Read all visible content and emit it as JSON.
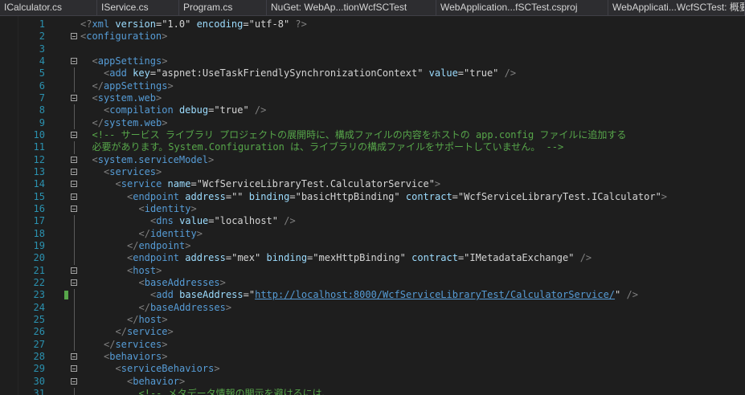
{
  "tabs": [
    {
      "label": "ICalculator.cs"
    },
    {
      "label": "IService.cs"
    },
    {
      "label": "Program.cs"
    },
    {
      "label": "NuGet: WebAp...tionWcfSCTest"
    },
    {
      "label": "WebApplication...fSCTest.csproj"
    },
    {
      "label": "WebApplicati...WcfSCTest: 概要"
    }
  ],
  "lines": [
    {
      "n": "1",
      "indent": 0,
      "fold": false,
      "tokens": [
        [
          "b",
          "<?"
        ],
        [
          "tag",
          "xml"
        ],
        [
          "txt",
          " "
        ],
        [
          "attr",
          "version"
        ],
        [
          "eq",
          "="
        ],
        [
          "q",
          "\""
        ],
        [
          "val",
          "1.0"
        ],
        [
          "q",
          "\""
        ],
        [
          "txt",
          " "
        ],
        [
          "attr",
          "encoding"
        ],
        [
          "eq",
          "="
        ],
        [
          "q",
          "\""
        ],
        [
          "val",
          "utf-8"
        ],
        [
          "q",
          "\""
        ],
        [
          "b",
          " ?>"
        ]
      ]
    },
    {
      "n": "2",
      "indent": 0,
      "fold": true,
      "tokens": [
        [
          "b",
          "<"
        ],
        [
          "tag",
          "configuration"
        ],
        [
          "b",
          ">"
        ]
      ]
    },
    {
      "n": "3",
      "indent": 0,
      "fold": false,
      "tokens": []
    },
    {
      "n": "4",
      "indent": 1,
      "fold": true,
      "tokens": [
        [
          "b",
          "<"
        ],
        [
          "tag",
          "appSettings"
        ],
        [
          "b",
          ">"
        ]
      ]
    },
    {
      "n": "5",
      "indent": 2,
      "fold": false,
      "tokens": [
        [
          "b",
          "<"
        ],
        [
          "tag",
          "add"
        ],
        [
          "txt",
          " "
        ],
        [
          "attr",
          "key"
        ],
        [
          "eq",
          "="
        ],
        [
          "q",
          "\""
        ],
        [
          "val",
          "aspnet:UseTaskFriendlySynchronizationContext"
        ],
        [
          "q",
          "\""
        ],
        [
          "txt",
          " "
        ],
        [
          "attr",
          "value"
        ],
        [
          "eq",
          "="
        ],
        [
          "q",
          "\""
        ],
        [
          "val",
          "true"
        ],
        [
          "q",
          "\""
        ],
        [
          "b",
          " />"
        ]
      ]
    },
    {
      "n": "6",
      "indent": 1,
      "fold": false,
      "tokens": [
        [
          "b",
          "</"
        ],
        [
          "tag",
          "appSettings"
        ],
        [
          "b",
          ">"
        ]
      ]
    },
    {
      "n": "7",
      "indent": 1,
      "fold": true,
      "tokens": [
        [
          "b",
          "<"
        ],
        [
          "tag",
          "system.web"
        ],
        [
          "b",
          ">"
        ]
      ]
    },
    {
      "n": "8",
      "indent": 2,
      "fold": false,
      "tokens": [
        [
          "b",
          "<"
        ],
        [
          "tag",
          "compilation"
        ],
        [
          "txt",
          " "
        ],
        [
          "attr",
          "debug"
        ],
        [
          "eq",
          "="
        ],
        [
          "q",
          "\""
        ],
        [
          "val",
          "true"
        ],
        [
          "q",
          "\""
        ],
        [
          "b",
          " />"
        ]
      ]
    },
    {
      "n": "9",
      "indent": 1,
      "fold": false,
      "tokens": [
        [
          "b",
          "</"
        ],
        [
          "tag",
          "system.web"
        ],
        [
          "b",
          ">"
        ]
      ]
    },
    {
      "n": "10",
      "indent": 1,
      "fold": true,
      "tokens": [
        [
          "c",
          "<!-- サービス ライブラリ プロジェクトの展開時に、構成ファイルの内容をホストの app.config ファイルに追加する"
        ]
      ]
    },
    {
      "n": "11",
      "indent": 1,
      "fold": false,
      "tokens": [
        [
          "c",
          "必要があります。System.Configuration は、ライブラリの構成ファイルをサポートしていません。 -->"
        ]
      ]
    },
    {
      "n": "12",
      "indent": 1,
      "fold": true,
      "tokens": [
        [
          "b",
          "<"
        ],
        [
          "tag",
          "system.serviceModel"
        ],
        [
          "b",
          ">"
        ]
      ]
    },
    {
      "n": "13",
      "indent": 2,
      "fold": true,
      "tokens": [
        [
          "b",
          "<"
        ],
        [
          "tag",
          "services"
        ],
        [
          "b",
          ">"
        ]
      ]
    },
    {
      "n": "14",
      "indent": 3,
      "fold": true,
      "tokens": [
        [
          "b",
          "<"
        ],
        [
          "tag",
          "service"
        ],
        [
          "txt",
          " "
        ],
        [
          "attr",
          "name"
        ],
        [
          "eq",
          "="
        ],
        [
          "q",
          "\""
        ],
        [
          "val",
          "WcfServiceLibraryTest.CalculatorService"
        ],
        [
          "q",
          "\""
        ],
        [
          "b",
          ">"
        ]
      ]
    },
    {
      "n": "15",
      "indent": 4,
      "fold": true,
      "tokens": [
        [
          "b",
          "<"
        ],
        [
          "tag",
          "endpoint"
        ],
        [
          "txt",
          " "
        ],
        [
          "attr",
          "address"
        ],
        [
          "eq",
          "="
        ],
        [
          "q",
          "\"\""
        ],
        [
          "txt",
          " "
        ],
        [
          "attr",
          "binding"
        ],
        [
          "eq",
          "="
        ],
        [
          "q",
          "\""
        ],
        [
          "val",
          "basicHttpBinding"
        ],
        [
          "q",
          "\""
        ],
        [
          "txt",
          " "
        ],
        [
          "attr",
          "contract"
        ],
        [
          "eq",
          "="
        ],
        [
          "q",
          "\""
        ],
        [
          "val",
          "WcfServiceLibraryTest.ICalculator"
        ],
        [
          "q",
          "\""
        ],
        [
          "b",
          ">"
        ]
      ]
    },
    {
      "n": "16",
      "indent": 5,
      "fold": true,
      "tokens": [
        [
          "b",
          "<"
        ],
        [
          "tag",
          "identity"
        ],
        [
          "b",
          ">"
        ]
      ]
    },
    {
      "n": "17",
      "indent": 6,
      "fold": false,
      "tokens": [
        [
          "b",
          "<"
        ],
        [
          "tag",
          "dns"
        ],
        [
          "txt",
          " "
        ],
        [
          "attr",
          "value"
        ],
        [
          "eq",
          "="
        ],
        [
          "q",
          "\""
        ],
        [
          "val",
          "localhost"
        ],
        [
          "q",
          "\""
        ],
        [
          "b",
          " />"
        ]
      ]
    },
    {
      "n": "18",
      "indent": 5,
      "fold": false,
      "tokens": [
        [
          "b",
          "</"
        ],
        [
          "tag",
          "identity"
        ],
        [
          "b",
          ">"
        ]
      ]
    },
    {
      "n": "19",
      "indent": 4,
      "fold": false,
      "tokens": [
        [
          "b",
          "</"
        ],
        [
          "tag",
          "endpoint"
        ],
        [
          "b",
          ">"
        ]
      ]
    },
    {
      "n": "20",
      "indent": 4,
      "fold": false,
      "tokens": [
        [
          "b",
          "<"
        ],
        [
          "tag",
          "endpoint"
        ],
        [
          "txt",
          " "
        ],
        [
          "attr",
          "address"
        ],
        [
          "eq",
          "="
        ],
        [
          "q",
          "\""
        ],
        [
          "val",
          "mex"
        ],
        [
          "q",
          "\""
        ],
        [
          "txt",
          " "
        ],
        [
          "attr",
          "binding"
        ],
        [
          "eq",
          "="
        ],
        [
          "q",
          "\""
        ],
        [
          "val",
          "mexHttpBinding"
        ],
        [
          "q",
          "\""
        ],
        [
          "txt",
          " "
        ],
        [
          "attr",
          "contract"
        ],
        [
          "eq",
          "="
        ],
        [
          "q",
          "\""
        ],
        [
          "val",
          "IMetadataExchange"
        ],
        [
          "q",
          "\""
        ],
        [
          "b",
          " />"
        ]
      ]
    },
    {
      "n": "21",
      "indent": 4,
      "fold": true,
      "tokens": [
        [
          "b",
          "<"
        ],
        [
          "tag",
          "host"
        ],
        [
          "b",
          ">"
        ]
      ]
    },
    {
      "n": "22",
      "indent": 5,
      "fold": true,
      "tokens": [
        [
          "b",
          "<"
        ],
        [
          "tag",
          "baseAddresses"
        ],
        [
          "b",
          ">"
        ]
      ]
    },
    {
      "n": "23",
      "indent": 6,
      "fold": false,
      "changed": true,
      "tokens": [
        [
          "b",
          "<"
        ],
        [
          "tag",
          "add"
        ],
        [
          "txt",
          " "
        ],
        [
          "attr",
          "baseAddress"
        ],
        [
          "eq",
          "="
        ],
        [
          "q",
          "\""
        ],
        [
          "link",
          "http://localhost:8000/WcfServiceLibraryTest/CalculatorService/"
        ],
        [
          "q",
          "\""
        ],
        [
          "b",
          " />"
        ]
      ]
    },
    {
      "n": "24",
      "indent": 5,
      "fold": false,
      "tokens": [
        [
          "b",
          "</"
        ],
        [
          "tag",
          "baseAddresses"
        ],
        [
          "b",
          ">"
        ]
      ]
    },
    {
      "n": "25",
      "indent": 4,
      "fold": false,
      "tokens": [
        [
          "b",
          "</"
        ],
        [
          "tag",
          "host"
        ],
        [
          "b",
          ">"
        ]
      ]
    },
    {
      "n": "26",
      "indent": 3,
      "fold": false,
      "tokens": [
        [
          "b",
          "</"
        ],
        [
          "tag",
          "service"
        ],
        [
          "b",
          ">"
        ]
      ]
    },
    {
      "n": "27",
      "indent": 2,
      "fold": false,
      "tokens": [
        [
          "b",
          "</"
        ],
        [
          "tag",
          "services"
        ],
        [
          "b",
          ">"
        ]
      ]
    },
    {
      "n": "28",
      "indent": 2,
      "fold": true,
      "tokens": [
        [
          "b",
          "<"
        ],
        [
          "tag",
          "behaviors"
        ],
        [
          "b",
          ">"
        ]
      ]
    },
    {
      "n": "29",
      "indent": 3,
      "fold": true,
      "tokens": [
        [
          "b",
          "<"
        ],
        [
          "tag",
          "serviceBehaviors"
        ],
        [
          "b",
          ">"
        ]
      ]
    },
    {
      "n": "30",
      "indent": 4,
      "fold": true,
      "tokens": [
        [
          "b",
          "<"
        ],
        [
          "tag",
          "behavior"
        ],
        [
          "b",
          ">"
        ]
      ]
    },
    {
      "n": "31",
      "indent": 5,
      "fold": false,
      "tokens": [
        [
          "c",
          "<!-- メタデータ情報の開示を避けるには、"
        ]
      ]
    }
  ],
  "colors": {
    "background": "#1e1e1e",
    "line_number": "#2b91af",
    "tag": "#569cd6",
    "attribute": "#9cdcfe",
    "comment": "#57a64a",
    "bracket": "#808080"
  }
}
